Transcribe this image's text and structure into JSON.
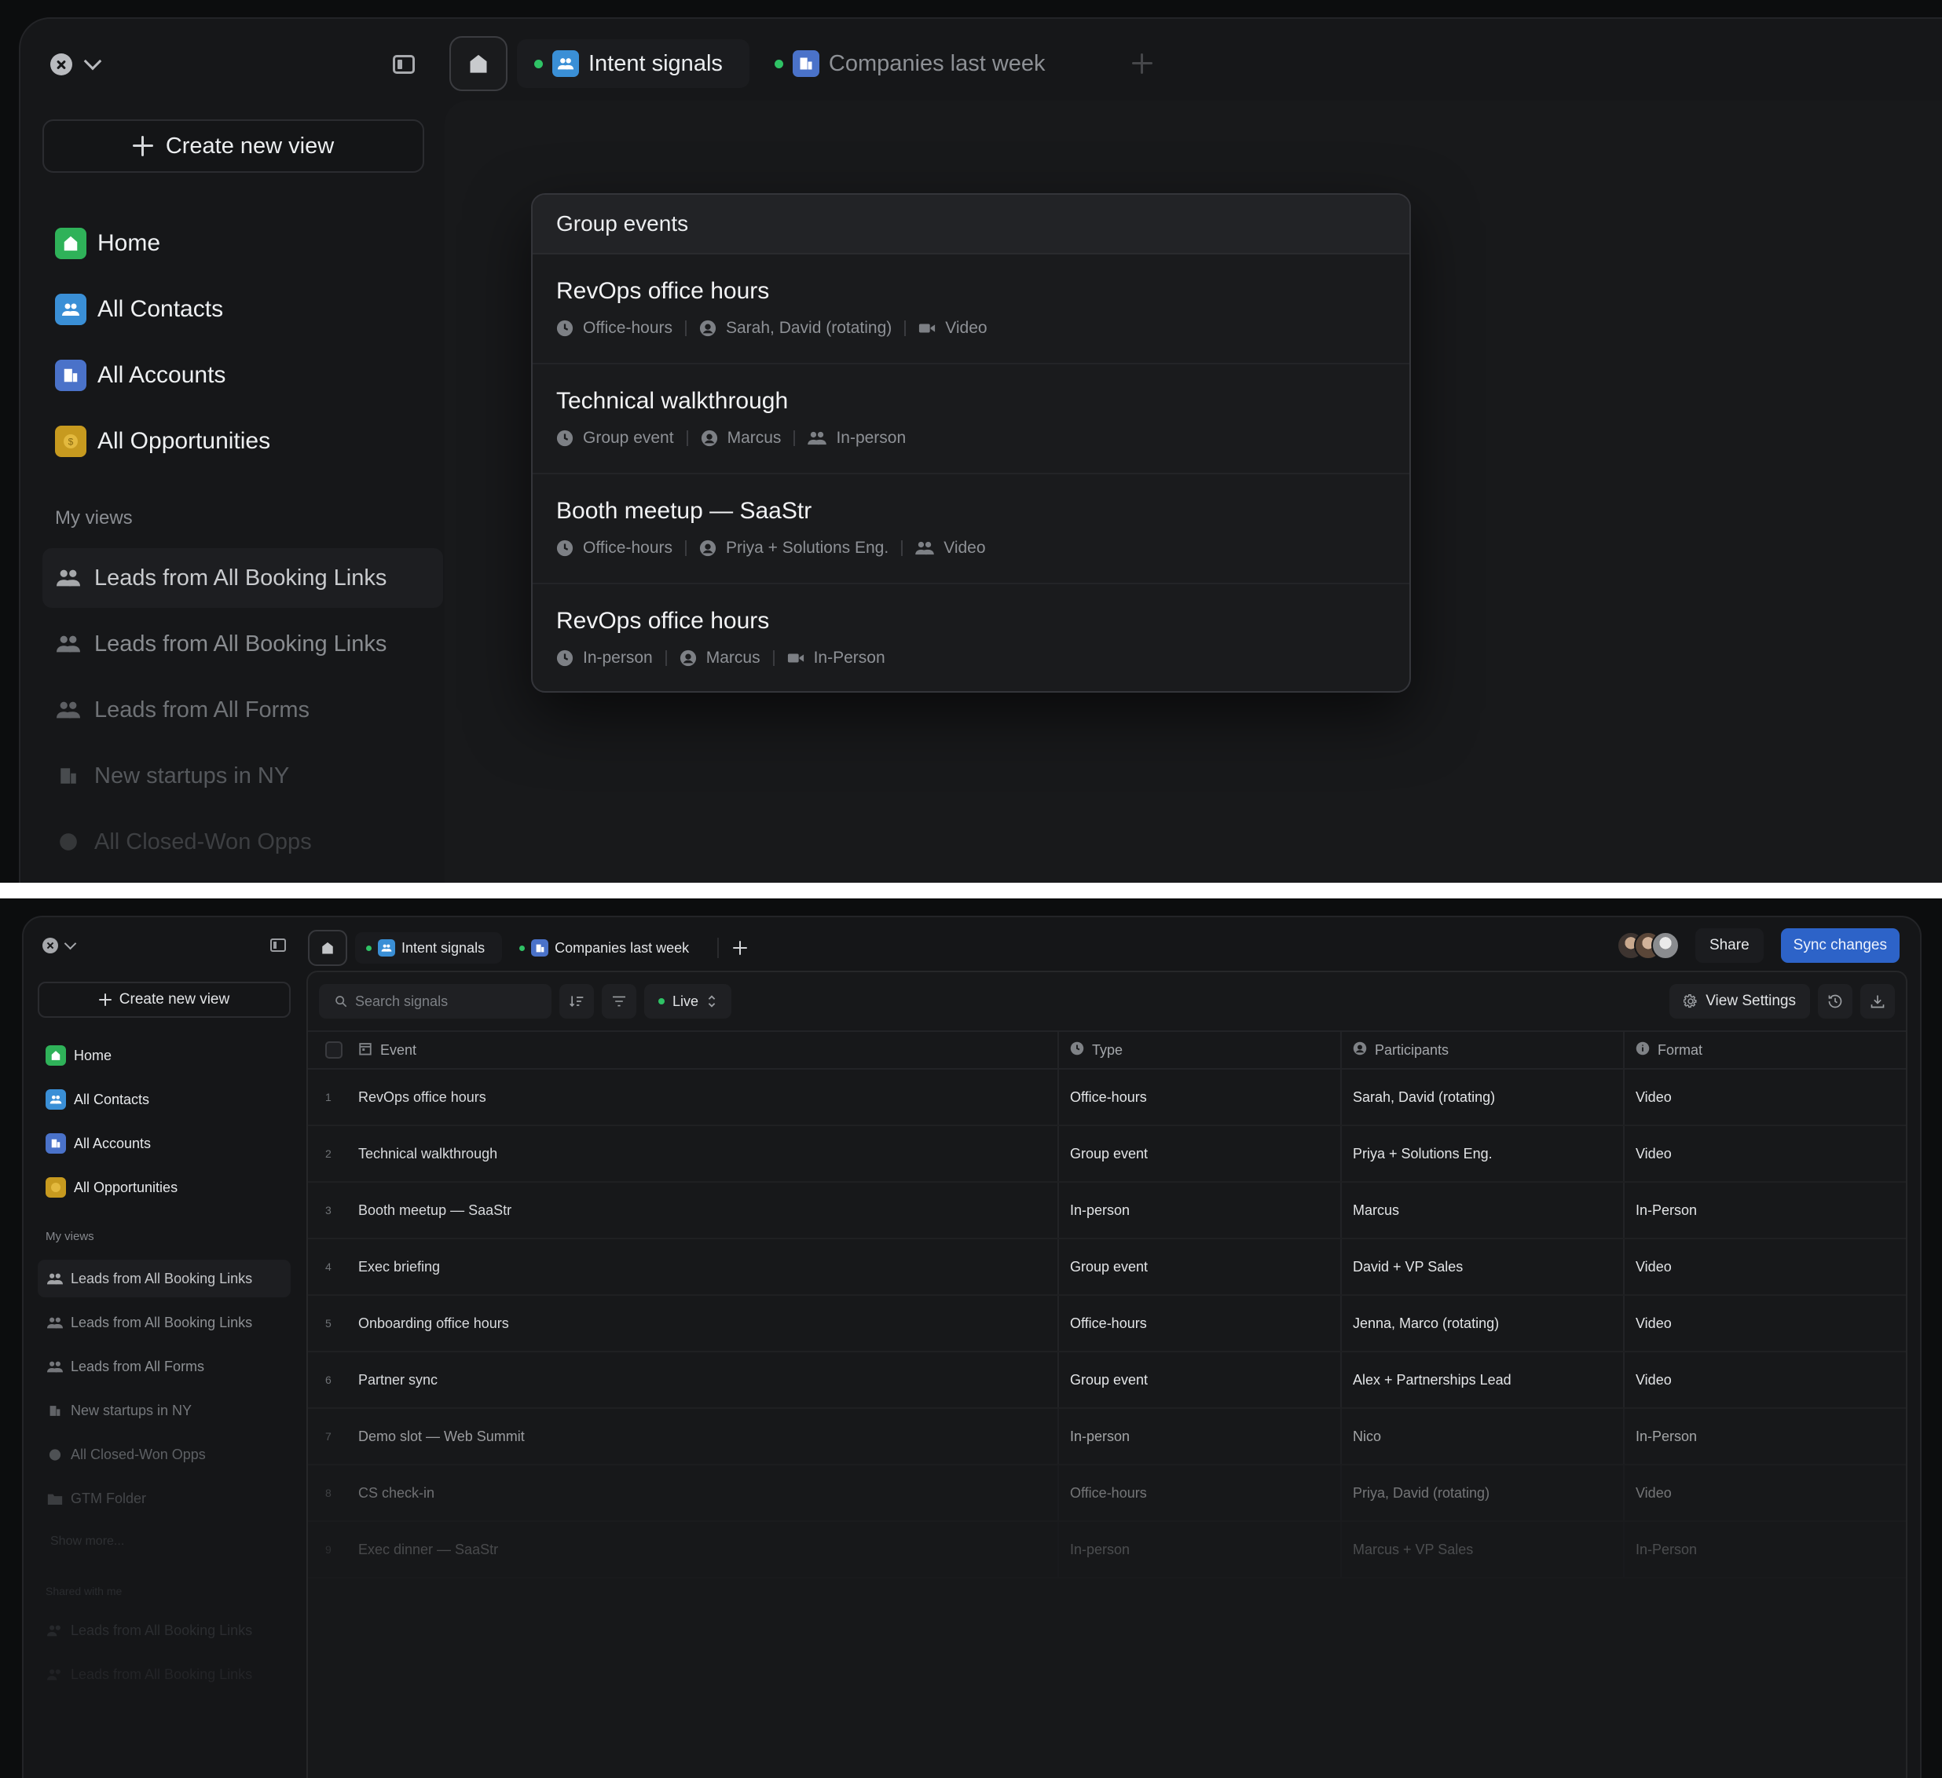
{
  "top": {
    "sidebar": {
      "create_label": "Create new view",
      "nav": [
        {
          "label": "Home",
          "icon": "home-icon",
          "color": "#2fb259"
        },
        {
          "label": "All Contacts",
          "icon": "contacts-icon",
          "color": "#3a8fd6"
        },
        {
          "label": "All Accounts",
          "icon": "building-icon",
          "color": "#4a72c9"
        },
        {
          "label": "All Opportunities",
          "icon": "coin-icon",
          "color": "#c79a1f"
        }
      ],
      "my_views_label": "My views",
      "views": [
        {
          "label": "Leads from All Booking Links",
          "icon": "people-icon"
        },
        {
          "label": "Leads from All Booking Links",
          "icon": "people-icon"
        },
        {
          "label": "Leads from All Forms",
          "icon": "people-icon"
        },
        {
          "label": "New startups in NY",
          "icon": "building-icon"
        },
        {
          "label": "All Closed-Won Opps",
          "icon": "coin-icon"
        }
      ]
    },
    "tabs": [
      {
        "label": "Intent signals",
        "active": true
      },
      {
        "label": "Companies last week",
        "active": false
      }
    ],
    "popup": {
      "title": "Group events",
      "events": [
        {
          "title": "RevOps office hours",
          "type": "Office-hours",
          "participants": "Sarah, David (rotating)",
          "format": "Video",
          "format_icon": "video-icon"
        },
        {
          "title": "Technical walkthrough",
          "type": "Group event",
          "participants": "Marcus",
          "format": "In-person",
          "format_icon": "people-icon"
        },
        {
          "title": "Booth meetup — SaaStr",
          "type": "Office-hours",
          "participants": "Priya + Solutions Eng.",
          "format": "Video",
          "format_icon": "people-icon"
        },
        {
          "title": "RevOps office hours",
          "type": "In-person",
          "participants": "Marcus",
          "format": "In-Person",
          "format_icon": "video-icon"
        }
      ]
    }
  },
  "bottom": {
    "sidebar": {
      "create_label": "Create new view",
      "nav": [
        {
          "label": "Home"
        },
        {
          "label": "All Contacts"
        },
        {
          "label": "All Accounts"
        },
        {
          "label": "All Opportunities"
        }
      ],
      "my_views_label": "My views",
      "views": [
        {
          "label": "Leads from All Booking Links",
          "icon": "people-icon"
        },
        {
          "label": "Leads from All Booking Links",
          "icon": "people-icon"
        },
        {
          "label": "Leads from All Forms",
          "icon": "people-icon"
        },
        {
          "label": "New startups in NY",
          "icon": "building-icon"
        },
        {
          "label": "All Closed-Won Opps",
          "icon": "coin-icon"
        },
        {
          "label": "GTM Folder",
          "icon": "folder-icon"
        }
      ],
      "show_more_label": "Show more...",
      "shared_label": "Shared with me",
      "shared_views": [
        {
          "label": "Leads from All Booking Links"
        },
        {
          "label": "Leads from All Booking Links"
        }
      ]
    },
    "tabs": [
      {
        "label": "Intent signals",
        "active": true
      },
      {
        "label": "Companies last week",
        "active": false
      }
    ],
    "header": {
      "share_label": "Share",
      "sync_label": "Sync changes"
    },
    "toolbar": {
      "search_placeholder": "Search signals",
      "live_label": "Live",
      "view_settings_label": "View Settings"
    },
    "table": {
      "columns": [
        "Event",
        "Type",
        "Participants",
        "Format"
      ],
      "rows": [
        {
          "num": "1",
          "event": "RevOps office hours",
          "type": "Office-hours",
          "participants": "Sarah, David (rotating)",
          "format": "Video"
        },
        {
          "num": "2",
          "event": "Technical walkthrough",
          "type": "Group event",
          "participants": "Priya + Solutions Eng.",
          "format": "Video"
        },
        {
          "num": "3",
          "event": "Booth meetup — SaaStr",
          "type": "In-person",
          "participants": "Marcus",
          "format": "In-Person"
        },
        {
          "num": "4",
          "event": "Exec briefing",
          "type": "Group event",
          "participants": "David + VP Sales",
          "format": "Video"
        },
        {
          "num": "5",
          "event": "Onboarding office hours",
          "type": "Office-hours",
          "participants": "Jenna, Marco (rotating)",
          "format": "Video"
        },
        {
          "num": "6",
          "event": "Partner sync",
          "type": "Group event",
          "participants": "Alex + Partnerships Lead",
          "format": "Video"
        },
        {
          "num": "7",
          "event": "Demo slot — Web Summit",
          "type": "In-person",
          "participants": "Nico",
          "format": "In-Person"
        },
        {
          "num": "8",
          "event": "CS check-in",
          "type": "Office-hours",
          "participants": "Priya, David (rotating)",
          "format": "Video"
        },
        {
          "num": "9",
          "event": "Exec dinner — SaaStr",
          "type": "In-person",
          "participants": "Marcus + VP Sales",
          "format": "In-Person"
        }
      ]
    }
  }
}
